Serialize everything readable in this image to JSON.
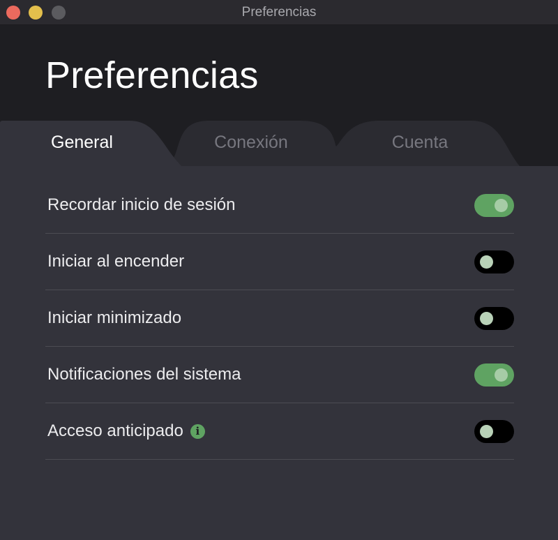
{
  "window": {
    "title": "Preferencias"
  },
  "header": {
    "title": "Preferencias"
  },
  "tabs": [
    {
      "label": "General",
      "active": true
    },
    {
      "label": "Conexión",
      "active": false
    },
    {
      "label": "Cuenta",
      "active": false
    }
  ],
  "settings": [
    {
      "label": "Recordar inicio de sesión",
      "enabled": true
    },
    {
      "label": "Iniciar al encender",
      "enabled": false
    },
    {
      "label": "Iniciar minimizado",
      "enabled": false
    },
    {
      "label": "Notificaciones del sistema",
      "enabled": true
    },
    {
      "label": "Acceso anticipado",
      "enabled": false,
      "info_icon": "info-icon"
    }
  ],
  "colors": {
    "accent": "#5fa362",
    "background": "#33333b",
    "header": "#1e1e22"
  }
}
